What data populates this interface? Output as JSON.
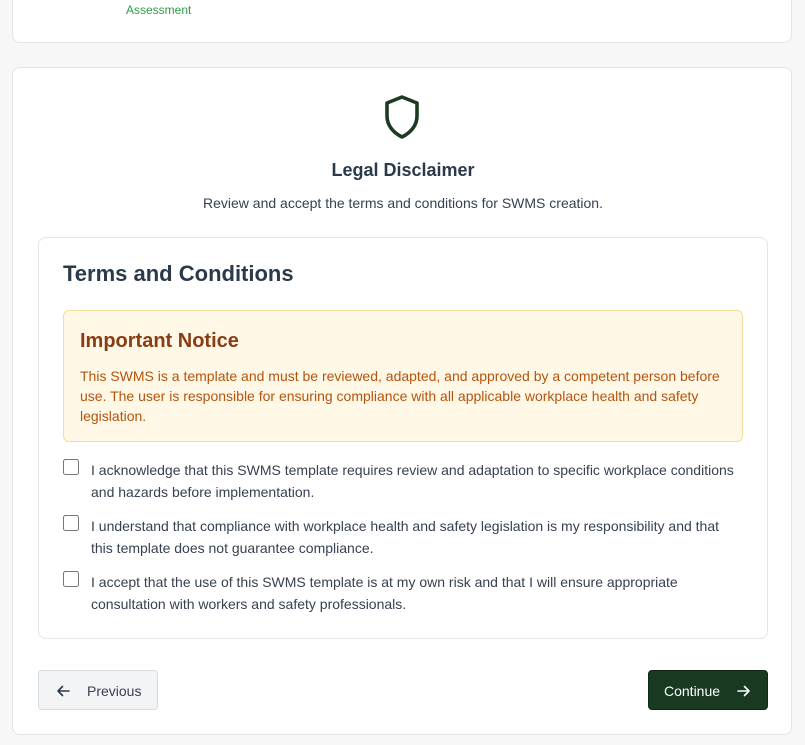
{
  "previous_step": {
    "label": "Assessment"
  },
  "disclaimer": {
    "title": "Legal Disclaimer",
    "subtitle": "Review and accept the terms and conditions for SWMS creation.",
    "icon": "shield-icon"
  },
  "terms": {
    "title": "Terms and Conditions",
    "notice": {
      "title": "Important Notice",
      "body": "This SWMS is a template and must be reviewed, adapted, and approved by a competent person before use. The user is responsible for ensuring compliance with all applicable workplace health and safety legislation."
    },
    "checkboxes": [
      {
        "label": "I acknowledge that this SWMS template requires review and adaptation to specific workplace conditions and hazards before implementation.",
        "checked": false
      },
      {
        "label": "I understand that compliance with workplace health and safety legislation is my responsibility and that this template does not guarantee compliance.",
        "checked": false
      },
      {
        "label": "I accept that the use of this SWMS template is at my own risk and that I will ensure appropriate consultation with workers and safety professionals.",
        "checked": false
      }
    ]
  },
  "navigation": {
    "previous_label": "Previous",
    "continue_label": "Continue"
  },
  "colors": {
    "primary": "#193a20",
    "notice_bg": "#fff8e6",
    "notice_title": "#8a3d12",
    "notice_text": "#b4540f",
    "step_label": "#2f9e44"
  }
}
